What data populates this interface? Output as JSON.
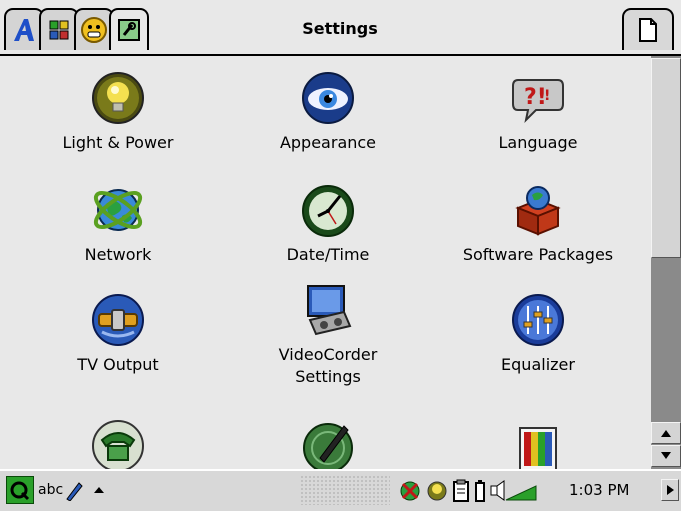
{
  "window": {
    "title": "Settings"
  },
  "tabs": [
    {
      "name": "applications-tab",
      "icon": "a-logo-icon"
    },
    {
      "name": "grid-tab",
      "icon": "grid-icon"
    },
    {
      "name": "games-tab",
      "icon": "smiley-icon"
    },
    {
      "name": "settings-tab",
      "icon": "settings-icon",
      "active": true
    }
  ],
  "settings": [
    {
      "label": "Light & Power",
      "icon": "lightbulb-icon"
    },
    {
      "label": "Appearance",
      "icon": "eye-icon"
    },
    {
      "label": "Language",
      "icon": "speech-bubble-icon"
    },
    {
      "label": "Network",
      "icon": "network-globe-icon"
    },
    {
      "label": "Date/Time",
      "icon": "clock-icon"
    },
    {
      "label": "Software Packages",
      "icon": "package-icon"
    },
    {
      "label": "TV Output",
      "icon": "tv-output-icon"
    },
    {
      "label": "VideoCorder\nSettings",
      "icon": "videocorder-icon"
    },
    {
      "label": "Equalizer",
      "icon": "equalizer-icon"
    }
  ],
  "partial_row_icons": [
    "phone-icon",
    "pen-icon",
    "colors-icon"
  ],
  "taskbar": {
    "input_mode": "abc",
    "clock": "1:03 PM"
  },
  "colors": {
    "accent_green": "#2aa02a",
    "icon_blue": "#2a5ab8"
  }
}
